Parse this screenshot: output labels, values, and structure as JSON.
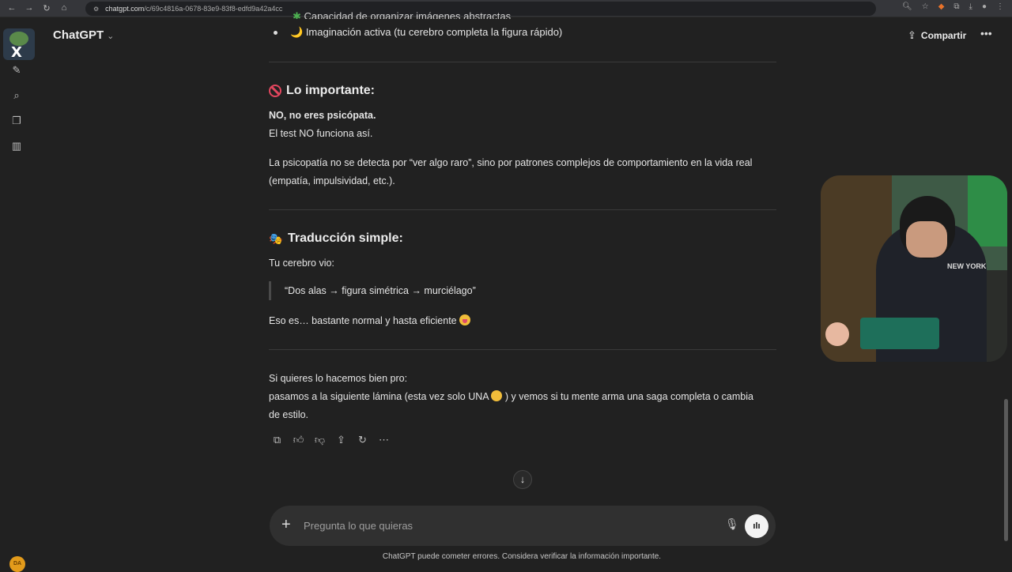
{
  "browser": {
    "url_host": "chatgpt.com",
    "url_path": "/c/69c4816a-0678-83e9-83f8-edfd9a42a4cc"
  },
  "header": {
    "title": "ChatGPT",
    "share_label": "Compartir"
  },
  "user": {
    "avatar_initials": "DA"
  },
  "message": {
    "truncated_line": "Capacidad de organizar imágenes abstractas",
    "bullet": "Imaginación activa (tu cerebro completa la figura rápido)",
    "bullet_emoji": "🌙",
    "section1": {
      "heading": "Lo importante:",
      "line1": "NO, no eres psicópata.",
      "line2": "El test NO funciona así.",
      "para": "La psicopatía no se detecta por “ver algo raro”, sino por patrones complejos de comportamiento en la vida real (empatía, impulsividad, etc.)."
    },
    "section2": {
      "heading": "Traducción simple:",
      "intro": "Tu cerebro vio:",
      "quote": "“Dos alas → figura simétrica → murciélago”",
      "para": "Eso es… bastante normal y hasta eficiente"
    },
    "closing": {
      "line1": "Si quieres lo hacemos bien pro:",
      "line2a": "pasamos a la siguiente lámina (esta vez solo UNA",
      "line2b": ") y vemos si tu mente arma una saga completa o cambia de estilo."
    }
  },
  "composer": {
    "placeholder": "Pregunta lo que quieras"
  },
  "footer": {
    "disclaimer": "ChatGPT puede cometer errores. Considera verificar la información importante."
  },
  "webcam": {
    "shirt_text": "NEW YORK"
  },
  "icons": {
    "new_chat": "edit-icon",
    "search": "search-icon",
    "images": "images-icon",
    "library": "library-icon"
  },
  "colors": {
    "background": "#212121",
    "composer": "#303030",
    "avatar": "#e39b1b",
    "no_entry": "#e2465e"
  }
}
